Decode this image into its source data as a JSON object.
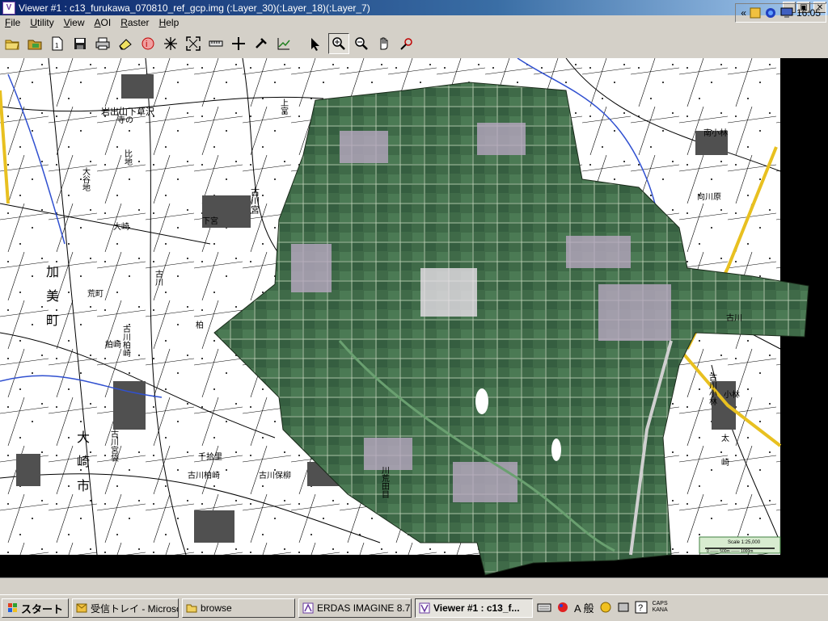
{
  "window": {
    "title": "Viewer #1 : c13_furukawa_070810_ref_gcp.img (:Layer_30)(:Layer_18)(:Layer_7)",
    "icon_letter": "V"
  },
  "menu": [
    {
      "label": "File",
      "u": "F",
      "rest": "ile"
    },
    {
      "label": "Utility",
      "u": "U",
      "rest": "tility"
    },
    {
      "label": "View",
      "u": "V",
      "rest": "iew"
    },
    {
      "label": "AOI",
      "u": "A",
      "rest": "OI"
    },
    {
      "label": "Raster",
      "u": "R",
      "rest": "aster"
    },
    {
      "label": "Help",
      "u": "H",
      "rest": "elp"
    }
  ],
  "toolbar_icons": [
    "open-folder-icon",
    "open-layer-icon",
    "new-viewer-icon",
    "save-icon",
    "print-icon",
    "erase-icon",
    "info-icon",
    "inquire-cursor-icon",
    "fit-window-icon",
    "measure-icon",
    "crosshair-icon",
    "roam-icon",
    "histogram-icon",
    "select-arrow-icon",
    "zoom-in-icon",
    "zoom-out-icon",
    "pan-hand-icon",
    "inquire-box-icon"
  ],
  "map_labels": [
    {
      "text": "岩出山下草沢"
    },
    {
      "text": "大谷地"
    },
    {
      "text": "比地"
    },
    {
      "text": "寺の"
    },
    {
      "text": "上宮"
    },
    {
      "text": "大崎"
    },
    {
      "text": "古川宮"
    },
    {
      "text": "下宮"
    },
    {
      "text": "古川"
    },
    {
      "text": "加"
    },
    {
      "text": "美"
    },
    {
      "text": "町"
    },
    {
      "text": "荒町"
    },
    {
      "text": "古川柏崎"
    },
    {
      "text": "柏崎"
    },
    {
      "text": "柏"
    },
    {
      "text": "大"
    },
    {
      "text": "崎"
    },
    {
      "text": "市"
    },
    {
      "text": "古川宮袋"
    },
    {
      "text": "千拾里"
    },
    {
      "text": "古川柏崎"
    },
    {
      "text": "古川保柳"
    },
    {
      "text": "川荒田目"
    },
    {
      "text": "古川"
    },
    {
      "text": "南小林"
    },
    {
      "text": "向川原"
    },
    {
      "text": "古川小林"
    },
    {
      "text": "小林"
    },
    {
      "text": "太"
    },
    {
      "text": "崎"
    }
  ],
  "scale_bar": {
    "label": "Scale 1:25,000",
    "sub": "0 ─── 500m ─── 1000m"
  },
  "taskbar": {
    "start_label": "スタート",
    "tasks": [
      {
        "label": "受信トレイ - Microsoft ...",
        "active": false
      },
      {
        "label": "browse",
        "active": false
      },
      {
        "label": "ERDAS IMAGINE 8.7",
        "active": false
      },
      {
        "label": "Viewer #1 : c13_f...",
        "active": true
      }
    ],
    "ime_text": "A 般",
    "caps_top": "CAPS",
    "caps_bottom": "KANA",
    "clock": "16:05"
  },
  "colors": {
    "title_start": "#0a246a",
    "title_end": "#a6caf0",
    "crop_green": "#3f6a48",
    "road_yellow": "#e8c020",
    "water_blue": "#3050d0"
  }
}
